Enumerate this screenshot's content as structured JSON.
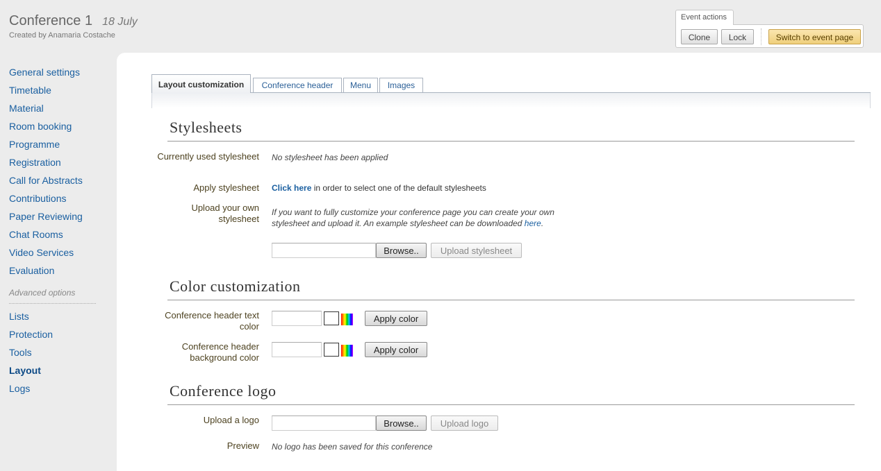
{
  "header": {
    "title": "Conference 1",
    "date": "18 July",
    "creator": "Created by Anamaria Costache"
  },
  "event_actions": {
    "label": "Event actions",
    "clone": "Clone",
    "lock": "Lock",
    "switch": "Switch to event page"
  },
  "sidebar": {
    "items": [
      "General settings",
      "Timetable",
      "Material",
      "Room booking",
      "Programme",
      "Registration",
      "Call for Abstracts",
      "Contributions",
      "Paper Reviewing",
      "Chat Rooms",
      "Video Services",
      "Evaluation"
    ],
    "advanced_label": "Advanced options",
    "advanced_items": [
      "Lists",
      "Protection",
      "Tools",
      "Layout",
      "Logs"
    ],
    "active_item": "Layout"
  },
  "tabs": [
    "Layout customization",
    "Conference header",
    "Menu",
    "Images"
  ],
  "stylesheets": {
    "title": "Stylesheets",
    "current_label": "Currently used stylesheet",
    "current_value": "No stylesheet has been applied",
    "apply_label": "Apply stylesheet",
    "apply_link": "Click here",
    "apply_text": " in order to select one of the default stylesheets",
    "upload_label": "Upload your own stylesheet",
    "upload_desc_line1": "If you want to fully customize your conference page you can create your own",
    "upload_desc_line2": "stylesheet and upload it. An example stylesheet can be downloaded ",
    "upload_desc_link": "here",
    "upload_desc_end": ".",
    "browse": "Browse..",
    "upload_button": "Upload stylesheet"
  },
  "colors": {
    "title": "Color customization",
    "text_color_label": "Conference header text color",
    "bg_color_label": "Conference header background color",
    "apply_color": "Apply color",
    "text_color_value": "",
    "bg_color_value": ""
  },
  "logo": {
    "title": "Conference logo",
    "upload_label": "Upload a logo",
    "browse": "Browse..",
    "upload_button": "Upload logo",
    "preview_label": "Preview",
    "preview_value": "No logo has been saved for this conference"
  }
}
